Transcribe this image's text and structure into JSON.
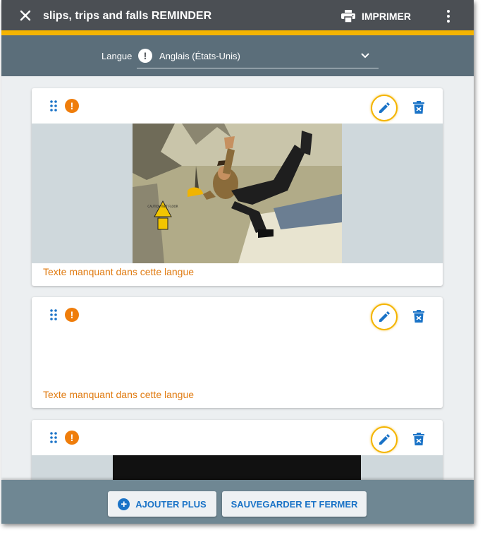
{
  "header": {
    "title": "slips, trips and falls REMINDER",
    "print_label": "IMPRIMER"
  },
  "language": {
    "label": "Langue",
    "selected": "Anglais (États-Unis)"
  },
  "cards": [
    {
      "missing_text": "Texte manquant dans cette langue",
      "image_caption": "CAUTION WET FLOOR"
    },
    {
      "missing_text": "Texte manquant dans cette langue"
    },
    {}
  ],
  "footer": {
    "add_label": "AJOUTER PLUS",
    "save_label": "SAUVEGARDER ET FERMER"
  },
  "colors": {
    "topbar": "#4b4f54",
    "accent": "#f4b400",
    "language_bar": "#5b6e7a",
    "footer": "#6f8793",
    "icon_blue": "#1a73c7",
    "warning_orange": "#ef7d0b"
  }
}
